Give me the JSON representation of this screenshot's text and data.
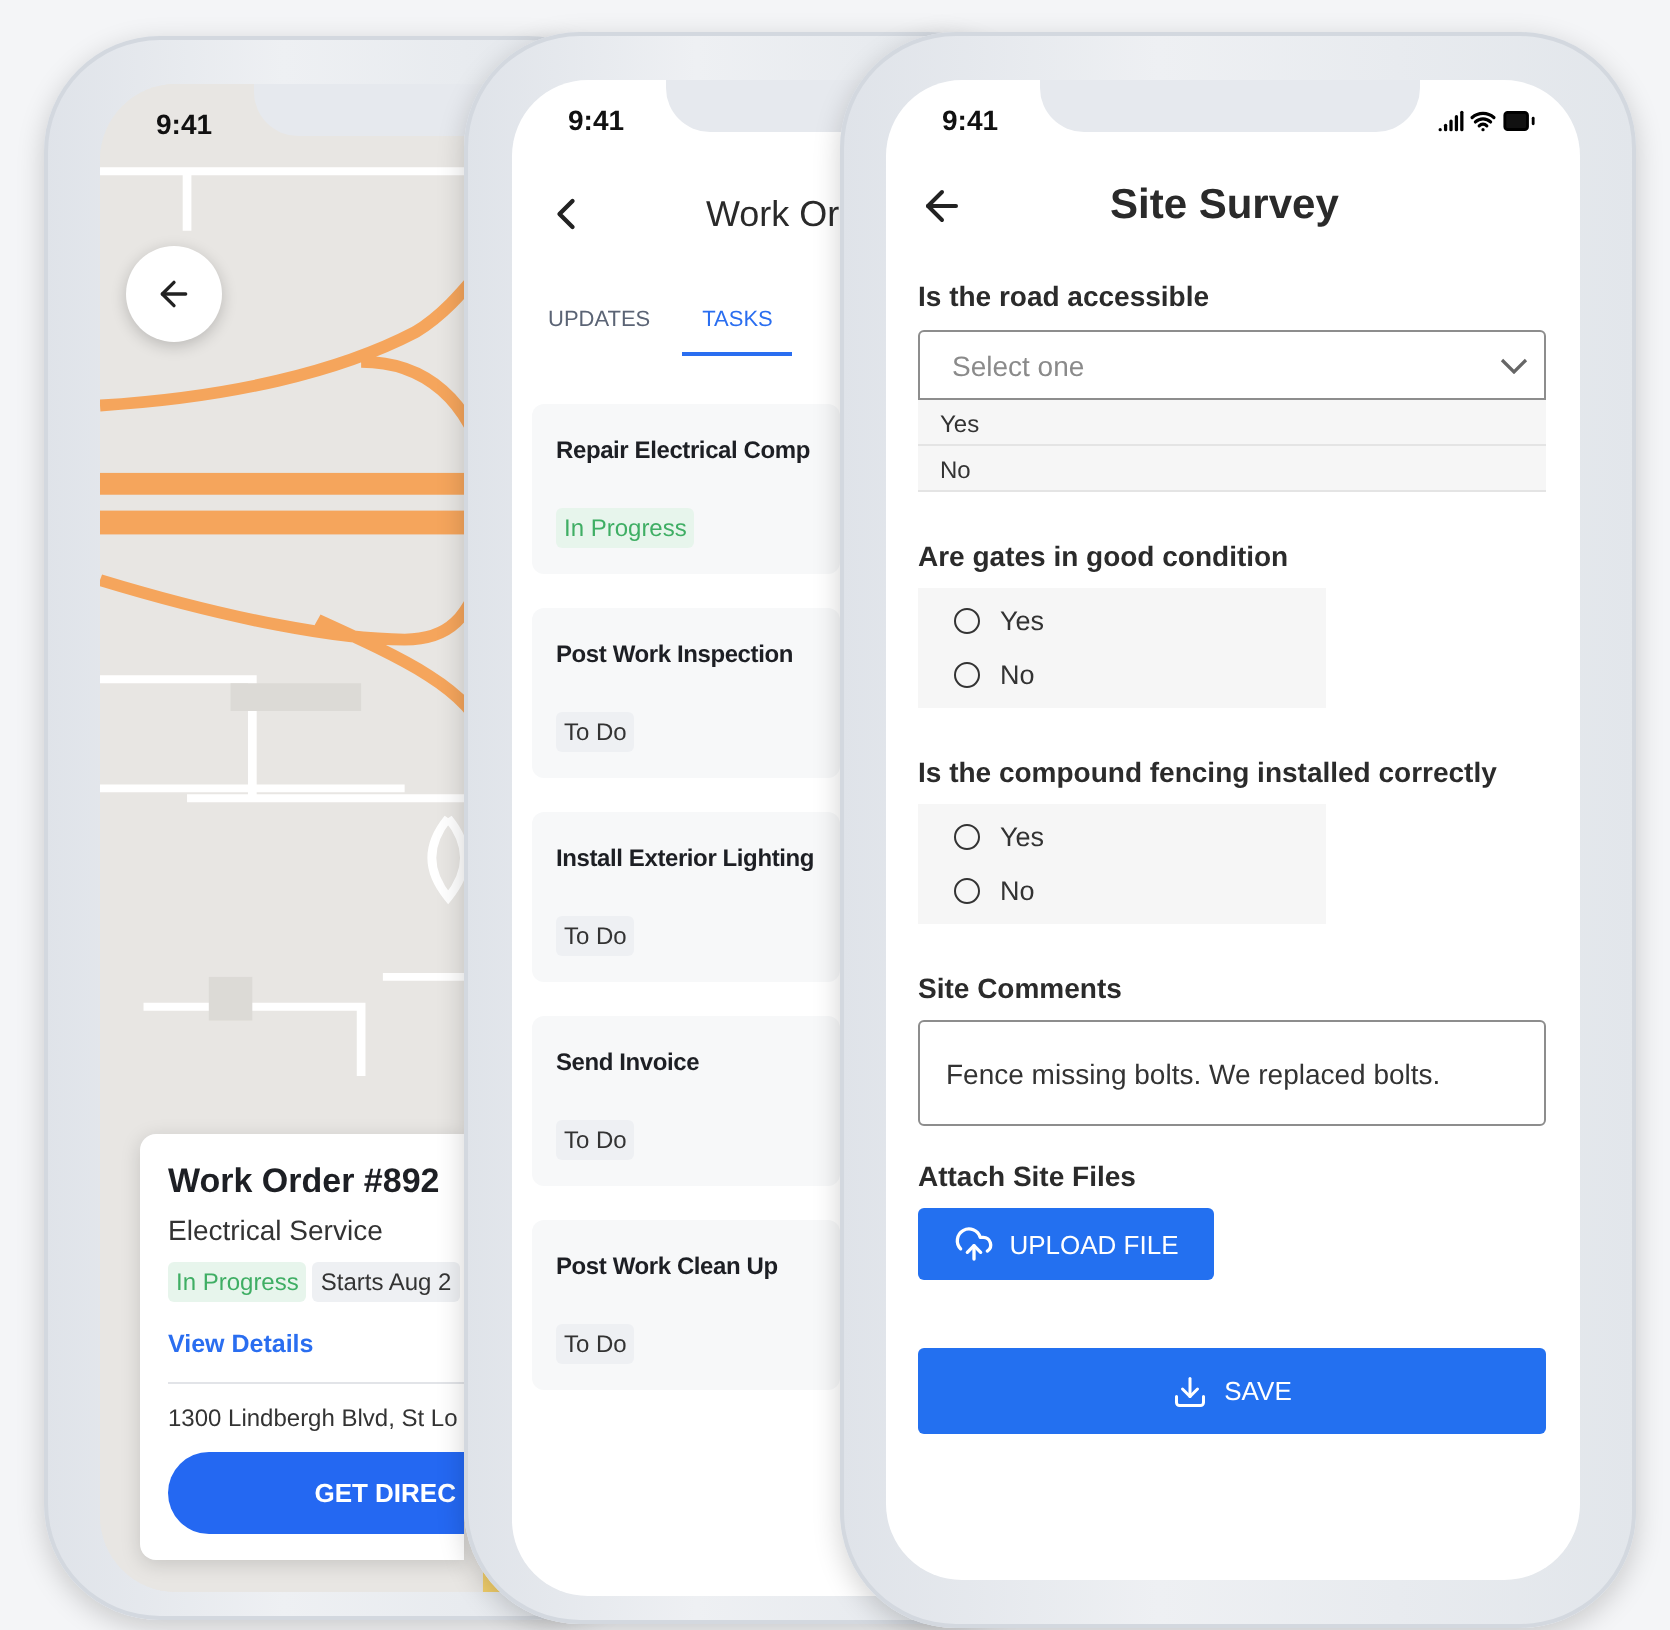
{
  "map_screen": {
    "time": "9:41",
    "card": {
      "title": "Work Order #892",
      "subtitle": "Electrical Service",
      "badges": [
        {
          "label": "In Progress",
          "kind": "status"
        },
        {
          "label": "Starts Aug 2",
          "kind": "date"
        }
      ],
      "link": "View Details",
      "address": "1300 Lindbergh Blvd, St Lo",
      "button": "GET DIREC"
    }
  },
  "work_order_screen": {
    "time": "9:41",
    "title": "Work Or",
    "tabs": [
      {
        "label": "UPDATES",
        "selected": false
      },
      {
        "label": "TASKS",
        "selected": true
      }
    ],
    "tasks": [
      {
        "title": "Repair Electrical Comp",
        "status": "In Progress",
        "kind": "in_progress"
      },
      {
        "title": "Post Work Inspection",
        "status": "To Do",
        "kind": "todo"
      },
      {
        "title": "Install Exterior Lighting",
        "status": "To Do",
        "kind": "todo"
      },
      {
        "title": "Send Invoice",
        "status": "To Do",
        "kind": "todo"
      },
      {
        "title": "Post Work Clean Up",
        "status": "To Do",
        "kind": "todo"
      }
    ]
  },
  "survey_screen": {
    "time": "9:41",
    "title": "Site Survey",
    "questions": [
      {
        "kind": "select",
        "label": "Is the road accessible",
        "placeholder": "Select one",
        "expanded": true,
        "options": [
          {
            "label": "Yes",
            "selected": false
          },
          {
            "label": "No",
            "selected": false
          }
        ]
      },
      {
        "kind": "radio",
        "label": "Are gates in good condition",
        "options": [
          {
            "label": "Yes",
            "selected": false
          },
          {
            "label": "No",
            "selected": false
          }
        ]
      },
      {
        "kind": "radio",
        "label": "Is the compound fencing installed correctly",
        "options": [
          {
            "label": "Yes",
            "selected": false
          },
          {
            "label": "No",
            "selected": false
          }
        ]
      },
      {
        "kind": "text",
        "label": "Site Comments",
        "value": "Fence missing bolts. We replaced bolts."
      },
      {
        "kind": "upload",
        "label": "Attach Site Files",
        "button": "UPLOAD FILE"
      }
    ],
    "save_button": "SAVE"
  }
}
